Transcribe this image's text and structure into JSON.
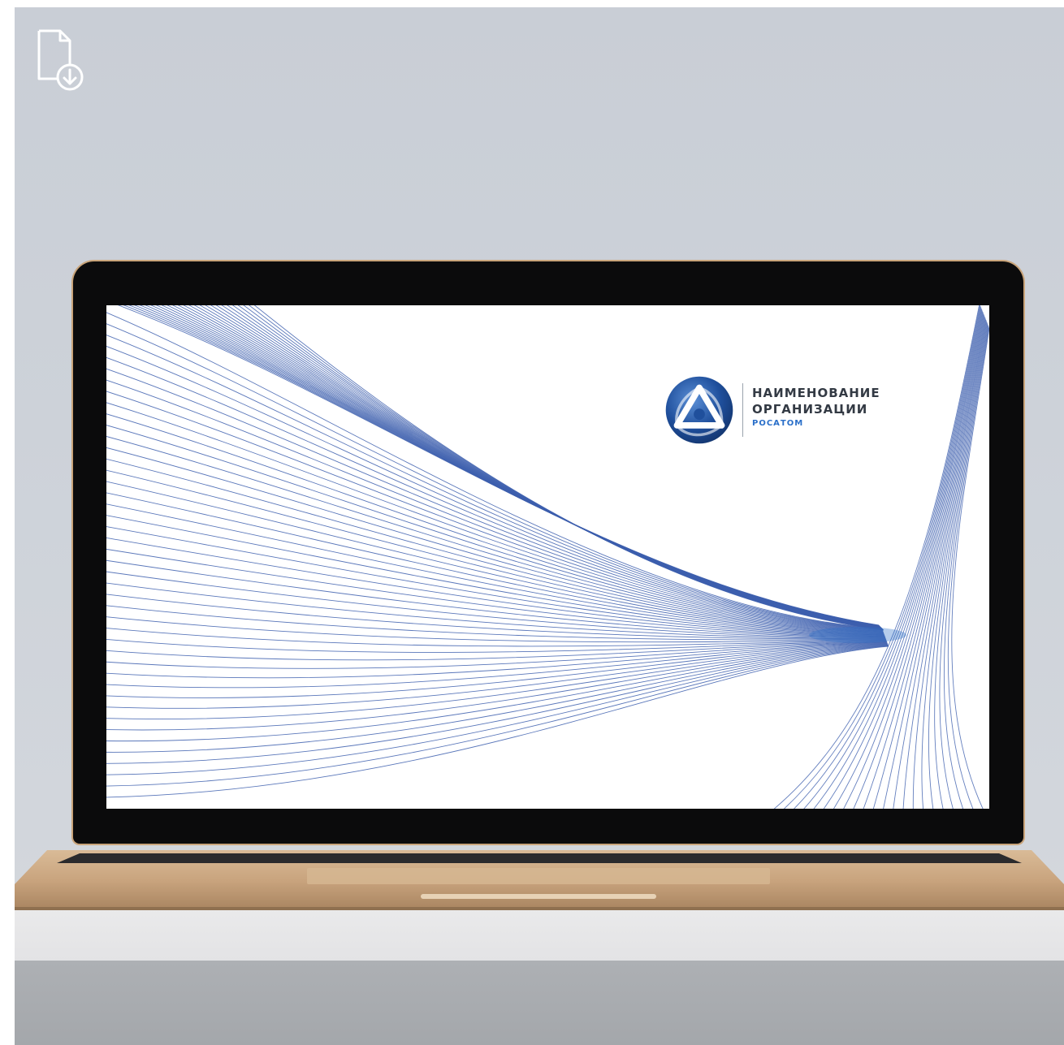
{
  "toolbar": {
    "download_icon": "file-download-icon",
    "download_color": "#ffffff"
  },
  "scene": {
    "wall_color": "#cdd2d9",
    "desk_color": "#e6e6e8",
    "laptop_frame_color": "#0b0b0c",
    "laptop_body_color": "#c9a47a"
  },
  "slide": {
    "org_name_line1": "НАИМЕНОВАНИЕ",
    "org_name_line2": "ОРГАНИЗАЦИИ",
    "brand": "РОСАТОМ",
    "logo_icon": "rosatom-logo-icon",
    "accent_color": "#2a6fc9",
    "line_color": "#3d5fae"
  }
}
